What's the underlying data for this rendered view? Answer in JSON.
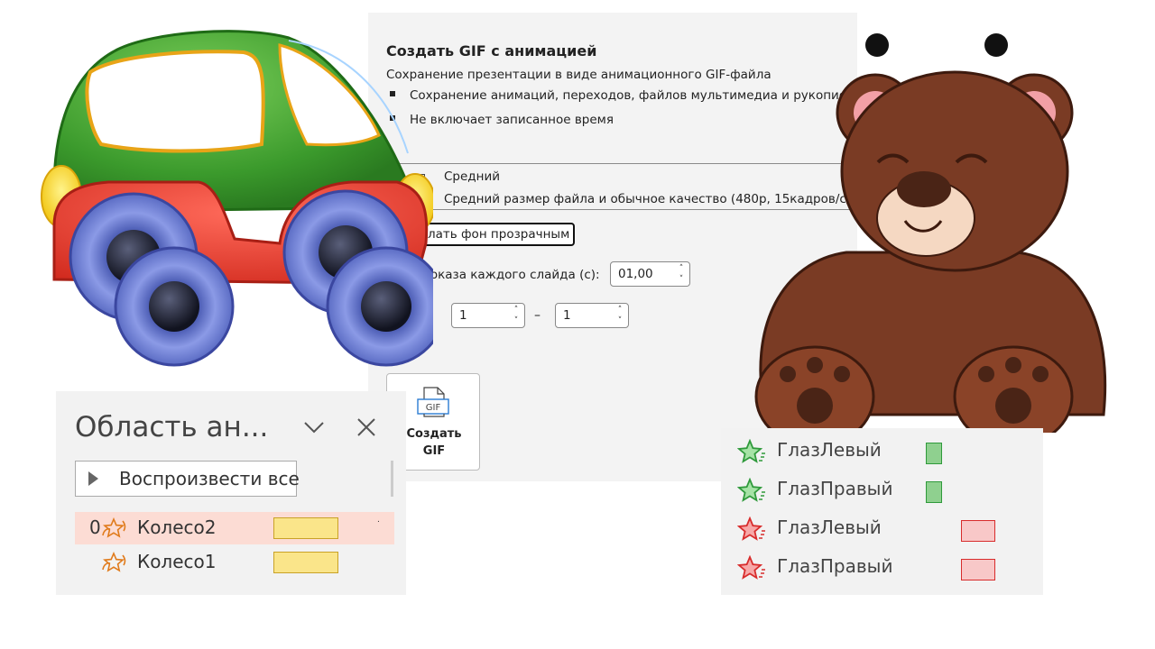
{
  "gif_panel": {
    "title": "Создать GIF с анимацией",
    "description": "Сохранение презентации в виде анимационного GIF-файла",
    "bullets": [
      "Сохранение анимаций, переходов, файлов мультимедиа и рукопис",
      "Не включает записанное время"
    ],
    "quality": {
      "name": "Средний",
      "description": "Средний размер файла и обычное качество (480p, 15кадров/с)"
    },
    "transparent_background_label": "лать фон прозрачным",
    "slide_duration_label": "показа каждого слайда (с):",
    "slide_duration_value": "01,00",
    "slides_from_value": "1",
    "slides_range_dash": "–",
    "slides_to_value": "1",
    "create_button_label": "Создать\nGIF",
    "create_button_icon": "gif-file-icon",
    "gif_icon_text": "GIF"
  },
  "animation_pane": {
    "title": "Область ан...",
    "play_all_label": "Воспроизвести все",
    "items": [
      {
        "order": "0",
        "name": "Колесо2",
        "effect_icon": "spin-effect-icon",
        "selected": true,
        "timing_color": "#fae58a",
        "extra": "."
      },
      {
        "order": "",
        "name": "Колесо1",
        "effect_icon": "spin-effect-icon",
        "selected": false,
        "timing_color": "#fae58a",
        "extra": ""
      }
    ]
  },
  "eyes_pane": {
    "items": [
      {
        "name": "ГлазЛевый",
        "effect": "entrance",
        "icon": "green-star-icon",
        "color": "#8fd08f"
      },
      {
        "name": "ГлазПравый",
        "effect": "entrance",
        "icon": "green-star-icon",
        "color": "#8fd08f"
      },
      {
        "name": "ГлазЛевый",
        "effect": "exit",
        "icon": "red-star-icon",
        "color": "#f8c8c8"
      },
      {
        "name": "ГлазПравый",
        "effect": "exit",
        "icon": "red-star-icon",
        "color": "#f8c8c8"
      }
    ]
  },
  "colors": {
    "panel_bg": "#f3f3f3",
    "selected_row": "#fcdcd4",
    "entrance_green": "#3da34a",
    "exit_red": "#e03a3a",
    "spin_orange": "#e07b1c"
  }
}
